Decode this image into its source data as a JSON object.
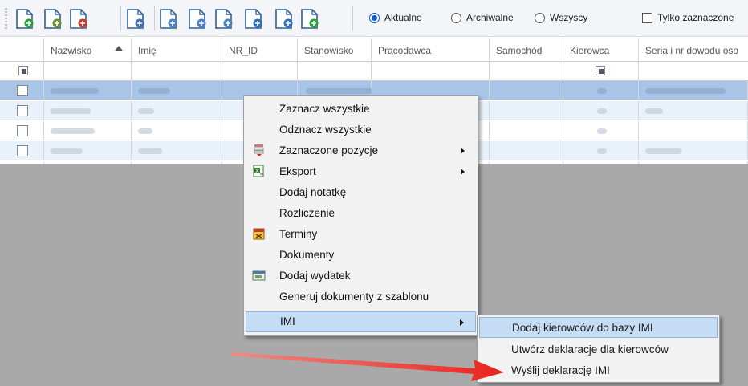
{
  "toolbar": {
    "buttons": [
      {
        "icon": "add-person-icon"
      },
      {
        "icon": "edit-person-icon"
      },
      {
        "icon": "delete-person-icon"
      },
      {
        "icon": "refresh-person-icon"
      },
      {
        "icon": "copy-person-icon"
      },
      {
        "icon": "archive-person-icon"
      },
      {
        "icon": "restore-person-icon"
      },
      {
        "icon": "export-person-icon"
      },
      {
        "icon": "forward-person-icon"
      },
      {
        "icon": "import-icon"
      }
    ],
    "filters": {
      "current": "Aktualne",
      "archived": "Archiwalne",
      "all": "Wszyscy",
      "selected": "Aktualne"
    },
    "only_checked": "Tylko zaznaczone"
  },
  "grid": {
    "columns": [
      "Nazwisko",
      "Imię",
      "NR_ID",
      "Stanowisko",
      "Pracodawca",
      "Samochód",
      "Kierowca",
      "Seria i nr dowodu oso"
    ],
    "sort_column": "Nazwisko"
  },
  "context_menu": {
    "items": [
      {
        "label": "Zaznacz wszystkie"
      },
      {
        "label": "Odznacz wszystkie"
      },
      {
        "label": "Zaznaczone pozycje",
        "icon": "selection-icon",
        "submenu": true
      },
      {
        "label": "Eksport",
        "icon": "excel-export-icon",
        "submenu": true
      },
      {
        "label": "Dodaj notatkę"
      },
      {
        "label": "Rozliczenie"
      },
      {
        "label": "Terminy",
        "icon": "calendar-icon"
      },
      {
        "label": "Dokumenty"
      },
      {
        "label": "Dodaj wydatek",
        "icon": "expense-icon"
      },
      {
        "label": "Generuj dokumenty z szablonu"
      },
      {
        "label": "IMI",
        "submenu": true,
        "highlighted": true
      }
    ]
  },
  "imi_submenu": {
    "items": [
      {
        "label": "Dodaj kierowców do bazy IMI",
        "highlighted": true
      },
      {
        "label": "Utwórz deklaracje dla kierowców"
      },
      {
        "label": "Wyślij deklarację IMI"
      }
    ]
  },
  "colors": {
    "selection": "#a8c4e6",
    "menu_highlight": "#c5dcf5",
    "arrow": "#e8231c",
    "radio_accent": "#0a5bd3"
  }
}
